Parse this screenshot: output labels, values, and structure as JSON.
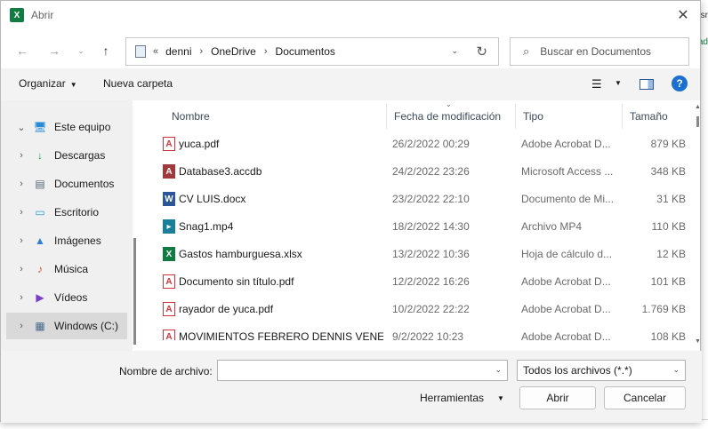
{
  "background": {
    "right_tab_text": "sr",
    "right_green_text": "ad"
  },
  "dialog": {
    "app_icon_letter": "X",
    "title": "Abrir",
    "close_glyph": "✕"
  },
  "nav": {
    "back_glyph": "←",
    "forward_glyph": "→",
    "recent_glyph": "⌄",
    "up_glyph": "↑",
    "address_overflow": "«",
    "breadcrumb": [
      "denni",
      "OneDrive",
      "Documentos"
    ],
    "breadcrumb_sep": "›",
    "address_dropdown": "⌄",
    "refresh_glyph": "↻",
    "search_placeholder": "Buscar en Documentos"
  },
  "toolbar": {
    "organize_label": "Organizar",
    "new_folder_label": "Nueva carpeta",
    "view_glyph": "☰",
    "view_dropdown": "▼",
    "help_label": "?"
  },
  "sidebar": {
    "items": [
      {
        "label": "Este equipo",
        "icon": "computer-icon",
        "glyph": "🖥",
        "chev": "⌄",
        "selected": false
      },
      {
        "label": "Descargas",
        "icon": "download-icon",
        "glyph": "↓",
        "chev": "›",
        "selected": false
      },
      {
        "label": "Documentos",
        "icon": "documents-icon",
        "glyph": "▤",
        "chev": "›",
        "selected": false
      },
      {
        "label": "Escritorio",
        "icon": "desktop-icon",
        "glyph": "▭",
        "chev": "›",
        "selected": false
      },
      {
        "label": "Imágenes",
        "icon": "pictures-icon",
        "glyph": "▲",
        "chev": "›",
        "selected": false
      },
      {
        "label": "Música",
        "icon": "music-icon",
        "glyph": "♪",
        "chev": "›",
        "selected": false
      },
      {
        "label": "Vídeos",
        "icon": "videos-icon",
        "glyph": "▶",
        "chev": "›",
        "selected": false
      },
      {
        "label": "Windows (C:)",
        "icon": "drive-icon",
        "glyph": "▦",
        "chev": "›",
        "selected": true
      }
    ]
  },
  "files": {
    "columns": {
      "name": "Nombre",
      "date": "Fecha de modificación",
      "type": "Tipo",
      "size": "Tamaño"
    },
    "sort_indicator": "⌄",
    "rows": [
      {
        "name": "yuca.pdf",
        "date": "26/2/2022 00:29",
        "type": "Adobe Acrobat D...",
        "size": "879 KB",
        "icon": "pdf-icon",
        "glyph": "A",
        "kind": "pdf"
      },
      {
        "name": "Database3.accdb",
        "date": "24/2/2022 23:26",
        "type": "Microsoft Access ...",
        "size": "348 KB",
        "icon": "access-icon",
        "glyph": "A",
        "kind": "acc"
      },
      {
        "name": "CV LUIS.docx",
        "date": "23/2/2022 22:10",
        "type": "Documento de Mi...",
        "size": "31 KB",
        "icon": "word-icon",
        "glyph": "W",
        "kind": "doc"
      },
      {
        "name": "Snag1.mp4",
        "date": "18/2/2022 14:30",
        "type": "Archivo MP4",
        "size": "110 KB",
        "icon": "video-file-icon",
        "glyph": "▸",
        "kind": "mp4"
      },
      {
        "name": "Gastos hamburguesa.xlsx",
        "date": "13/2/2022 10:36",
        "type": "Hoja de cálculo d...",
        "size": "12 KB",
        "icon": "excel-icon",
        "glyph": "X",
        "kind": "xls"
      },
      {
        "name": "Documento sin título.pdf",
        "date": "12/2/2022 16:26",
        "type": "Adobe Acrobat D...",
        "size": "101 KB",
        "icon": "pdf-icon",
        "glyph": "A",
        "kind": "pdf"
      },
      {
        "name": "rayador de yuca.pdf",
        "date": "10/2/2022 22:22",
        "type": "Adobe Acrobat D...",
        "size": "1.769 KB",
        "icon": "pdf-icon",
        "glyph": "A",
        "kind": "pdf"
      },
      {
        "name": "MOVIMIENTOS FEBRERO DENNIS VENEZ...",
        "date": "9/2/2022 10:23",
        "type": "Adobe Acrobat D...",
        "size": "108 KB",
        "icon": "pdf-icon",
        "glyph": "A",
        "kind": "pdf"
      }
    ]
  },
  "footer": {
    "filename_label": "Nombre de archivo:",
    "filename_value": "",
    "filename_dropdown": "⌄",
    "filetype_value": "Todos los archivos (*.*)",
    "filetype_dropdown": "⌄",
    "tools_label": "Herramientas",
    "tools_dropdown": "▼",
    "open_label": "Abrir",
    "cancel_label": "Cancelar"
  },
  "colors": {
    "excel_green": "#107c41",
    "pdf_red": "#d13438",
    "access_red": "#a4373a",
    "word_blue": "#2b579a",
    "help_blue": "#1a6fd0"
  }
}
